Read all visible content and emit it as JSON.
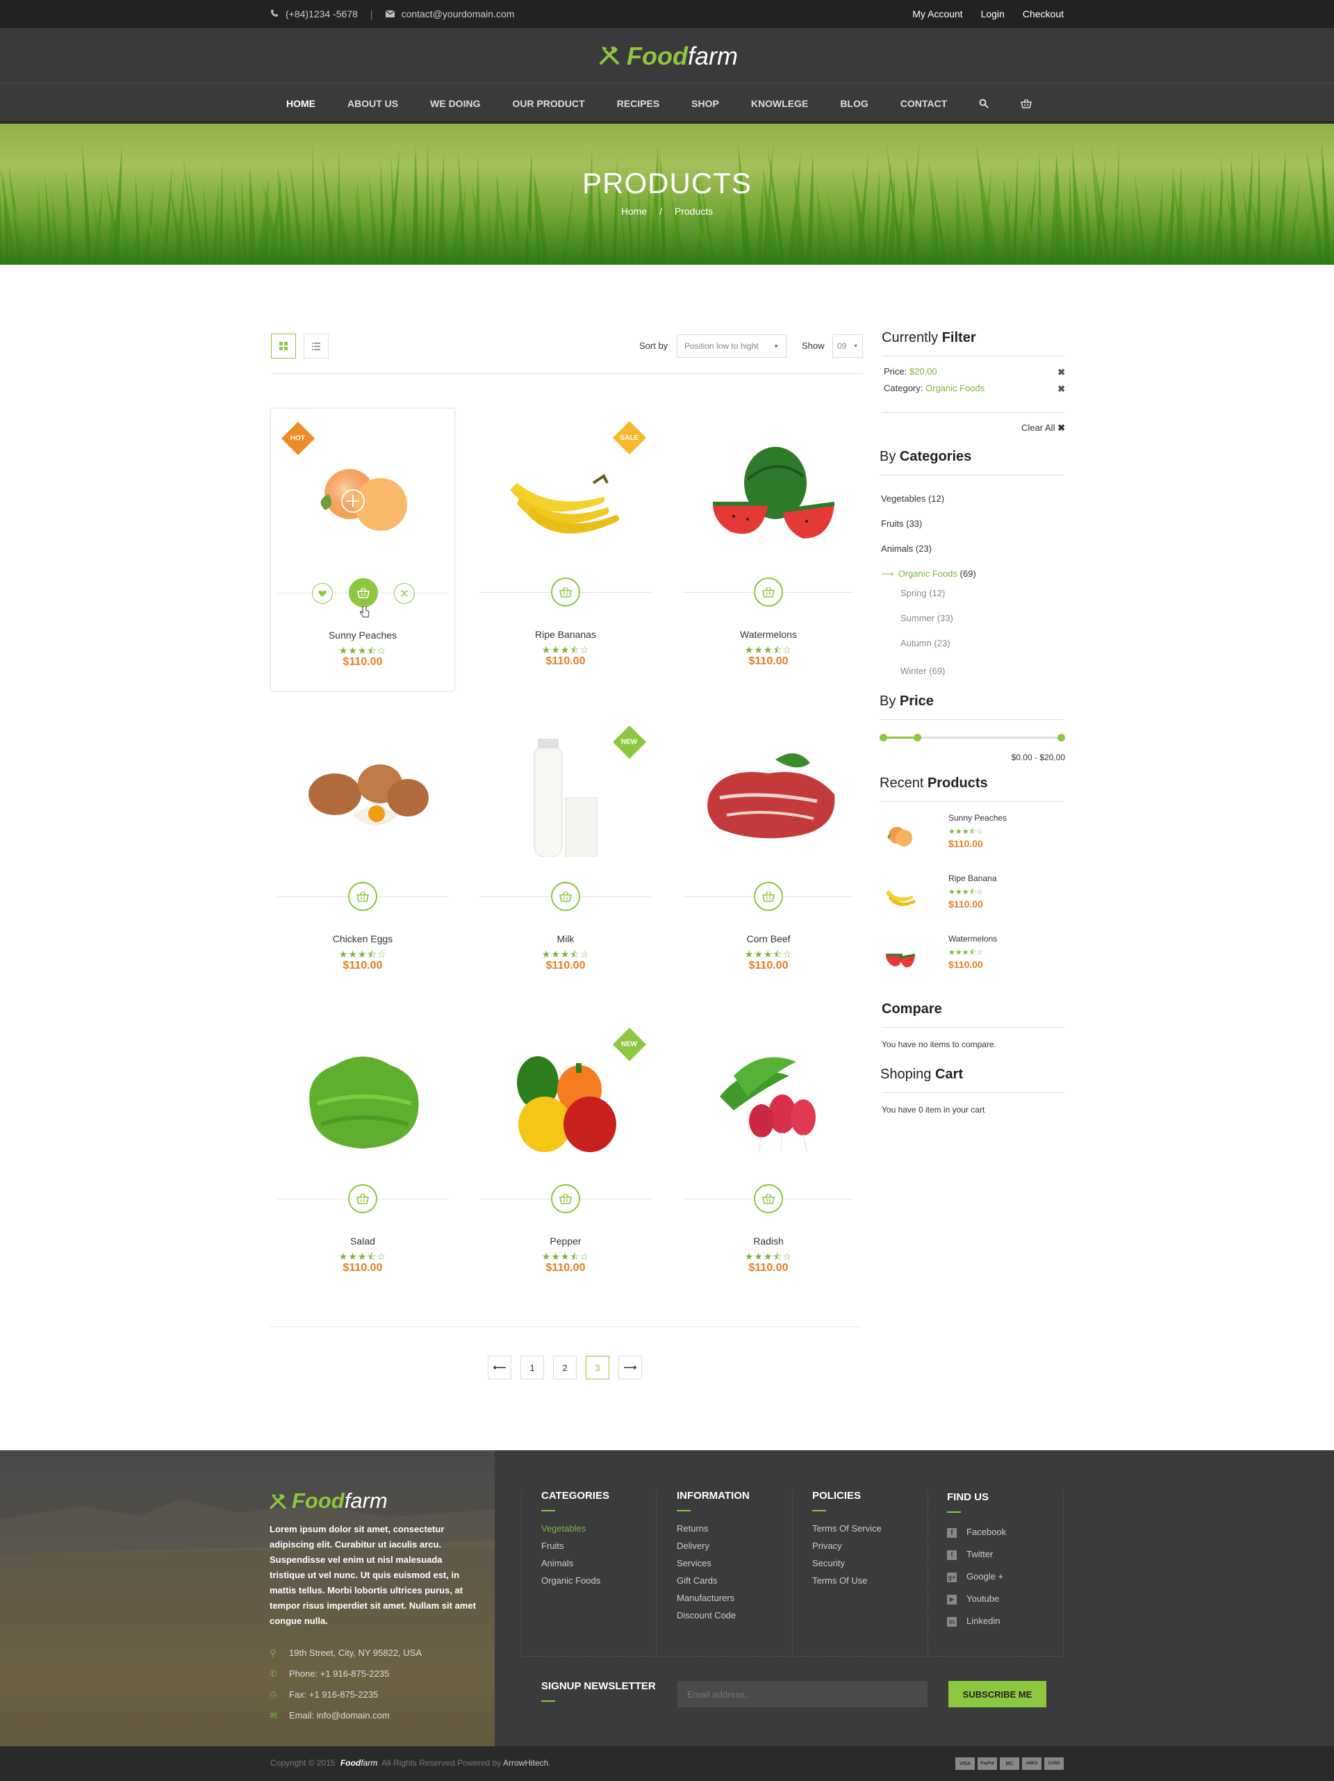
{
  "colors": {
    "accent": "#8dc63f",
    "price": "#e67e22",
    "topbar": "#222222",
    "header": "#3a3a3c"
  },
  "topbar": {
    "phone": "(+84)1234 -5678",
    "separator": "|",
    "email": "contact@yourdomain.com",
    "links": [
      "My Account",
      "Login",
      "Checkout"
    ]
  },
  "brand": {
    "part1": "Food",
    "part2": "farm"
  },
  "nav": {
    "items": [
      "HOME",
      "ABOUT US",
      "WE DOING",
      "OUR PRODUCT",
      "RECIPES",
      "SHOP",
      "KNOWLEGE",
      "BLOG",
      "CONTACT"
    ],
    "active": "HOME",
    "icons": [
      "search-icon",
      "cart-icon"
    ]
  },
  "hero": {
    "title": "PRODUCTS",
    "breadcrumb": {
      "home": "Home",
      "sep": "/",
      "current": "Products"
    }
  },
  "toolbar": {
    "sort_label": "Sort by",
    "sort_value": "Position low to hight",
    "show_label": "Show",
    "show_value": "09"
  },
  "products": [
    {
      "name": "Sunny Peaches",
      "price": "$110.00",
      "rating": 3.5,
      "stars": "★★★⯪☆",
      "badge": "HOT",
      "badge_color": "#f08a24"
    },
    {
      "name": "Ripe Bananas",
      "price": "$110.00",
      "rating": 3.5,
      "stars": "★★★⯪☆",
      "badge": "SALE",
      "badge_color": "#f5b82e"
    },
    {
      "name": "Watermelons",
      "price": "$110.00",
      "rating": 3.5,
      "stars": "★★★⯪☆",
      "badge": ""
    },
    {
      "name": "Chicken Eggs",
      "price": "$110.00",
      "rating": 3.5,
      "stars": "★★★⯪☆",
      "badge": ""
    },
    {
      "name": "Milk",
      "price": "$110.00",
      "rating": 3.5,
      "stars": "★★★⯪☆",
      "badge": "NEW",
      "badge_color": "#8dc63f"
    },
    {
      "name": "Corn Beef",
      "price": "$110.00",
      "rating": 3.5,
      "stars": "★★★⯪☆",
      "badge": ""
    },
    {
      "name": "Salad",
      "price": "$110.00",
      "rating": 3.5,
      "stars": "★★★⯪☆",
      "badge": ""
    },
    {
      "name": "Pepper",
      "price": "$110.00",
      "rating": 3.5,
      "stars": "★★★⯪☆",
      "badge": "NEW",
      "badge_color": "#8dc63f"
    },
    {
      "name": "Radish",
      "price": "$110.00",
      "rating": 3.5,
      "stars": "★★★⯪☆",
      "badge": ""
    }
  ],
  "pagination": {
    "prev": "⟵",
    "pages": [
      "1",
      "2",
      "3"
    ],
    "current": "3",
    "next": "⟶"
  },
  "sidebar": {
    "filter": {
      "title_light": "Currently",
      "title_bold": "Filter",
      "price_label": "Price:",
      "price_value": "$20,00",
      "category_label": "Category:",
      "category_value": "Organic Foods",
      "clear_all": "Clear All"
    },
    "categories": {
      "title_light": "By",
      "title_bold": "Categories",
      "items": [
        "Vegetables (12)",
        "Fruits (33)",
        "Animals (23)"
      ],
      "active_name": "Organic Foods",
      "active_count": "(69)",
      "sub": [
        "Spring (12)",
        "Summer (33)",
        "Autumn (23)",
        "Winter (69)"
      ]
    },
    "price": {
      "title_light": "By",
      "title_bold": "Price",
      "range": "$0.00 - $20,00",
      "slider_low": 0.2,
      "slider_high": 1.0
    },
    "recent": {
      "title_light": "Recent",
      "title_bold": "Products",
      "items": [
        {
          "name": "Sunny Peaches",
          "price": "$110.00",
          "stars": "★★★⯪☆"
        },
        {
          "name": "Ripe Banana",
          "price": "$110.00",
          "stars": "★★★⯪☆"
        },
        {
          "name": "Watermelons",
          "price": "$110.00",
          "stars": "★★★⯪☆"
        }
      ]
    },
    "compare": {
      "title": "Compare",
      "text": "You have no items to compare."
    },
    "cart": {
      "title_light": "Shoping",
      "title_bold": "Cart",
      "text": "You have 0 item in your cart"
    }
  },
  "footer": {
    "about": "Lorem ipsum dolor sit amet, consectetur adipiscing elit. Curabitur ut iaculis arcu. Suspendisse vel enim ut nisl malesuada tristique ut vel nunc. Ut quis euismod est, in mattis tellus. Morbi lobortis ultrices purus, at tempor risus imperdiet sit amet. Nullam sit amet congue nulla.",
    "address": "19th Street, City, NY 95822, USA",
    "phone": "Phone: +1 916-875-2235",
    "fax": "Fax: +1 916-875-2235",
    "email": "Email: info@domain.com",
    "categories": {
      "title": "CATEGORIES",
      "items": [
        "Vegetables",
        "Fruits",
        "Animals",
        "Organic Foods"
      ]
    },
    "information": {
      "title": "INFORMATION",
      "items": [
        "Returns",
        "Delivery",
        "Services",
        "Gift Cards",
        "Manufacturers",
        "Discount Code"
      ]
    },
    "policies": {
      "title": "POLICIES",
      "items": [
        "Terms Of Service",
        "Privacy",
        "Security",
        "Terms Of Use"
      ]
    },
    "findus": {
      "title": "FIND US",
      "items": [
        "Facebook",
        "Twitter",
        "Google +",
        "Youtube",
        "Linkedin"
      ]
    },
    "newsletter": {
      "title": "SIGNUP NEWSLETTER",
      "placeholder": "Email address..",
      "button": "SUBSCRIBE ME"
    },
    "copyright": {
      "pre": "Copyright © 2015",
      "brand1": "Food",
      "brand2": "farm",
      "mid": ". All Rights Reserved.Powered by",
      "by": "ArrowHitech",
      "end": "."
    },
    "payments": [
      "VISA",
      "PayPal",
      "MC",
      "AMEX",
      "CARD"
    ]
  }
}
